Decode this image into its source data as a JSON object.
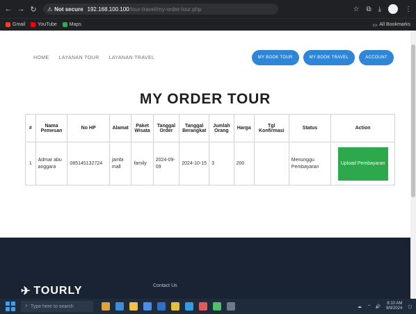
{
  "browser": {
    "security_label": "Not secure",
    "url_host": "192.168.100.100",
    "url_path": "/tour-travel/my-order-tour.php",
    "bookmarks": [
      {
        "label": "Gmail",
        "color": "#ea4335"
      },
      {
        "label": "YouTube",
        "color": "#ff0000"
      },
      {
        "label": "Maps",
        "color": "#34a853"
      }
    ],
    "all_bookmarks_label": "All Bookmarks"
  },
  "nav": {
    "links": [
      "HOME",
      "LAYANAN TOUR",
      "LAYANAN TRAVEL"
    ],
    "buttons": [
      "MY BOOK TOUR",
      "MY BOOK TRAVEL",
      "ACCOUNT"
    ]
  },
  "page_title": "MY ORDER TOUR",
  "table": {
    "headers": [
      "#",
      "Nama Pemesan",
      "No HP",
      "Alamat",
      "Paket Wisata",
      "Tanggal Order",
      "Tanggal Berangkat",
      "Jumlah Orang",
      "Harga",
      "Tgl Konfirmasi",
      "Status",
      "Action"
    ],
    "rows": [
      {
        "no": "1",
        "nama": "Admar abu anggara",
        "hp": "085145132724",
        "alamat": "jambi mall",
        "paket": "family",
        "tgl_order": "2024-09-09",
        "tgl_berangkat": "2024-10-15",
        "jumlah": "3",
        "harga": "200",
        "tgl_konfirmasi": "",
        "status": "Menunggu Pembayaran",
        "action": "Upload Pembayaran"
      }
    ]
  },
  "footer": {
    "brand": "TOURLY",
    "contact_label": "Contact Us"
  },
  "taskbar": {
    "search_placeholder": "Type here to search",
    "clock_time": "8:10 AM",
    "clock_date": "9/9/2024"
  },
  "colors": {
    "accent": "#2f86d6",
    "upload_btn": "#2ea84c",
    "footer_bg": "#1a2333"
  }
}
